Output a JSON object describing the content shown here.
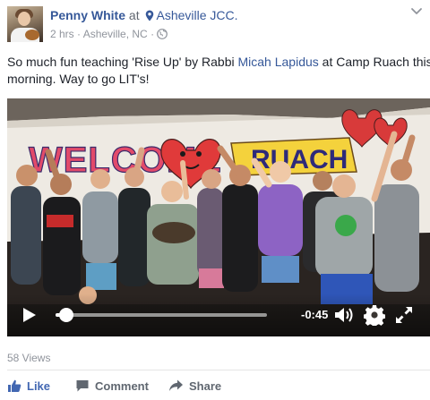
{
  "post": {
    "author": "Penny White",
    "at_text": "at",
    "location": "Asheville JCC.",
    "time": "2 hrs",
    "separator": "·",
    "city": "Asheville, NC",
    "text_before": "So much fun teaching 'Rise Up' by Rabbi ",
    "text_link": "Micah Lapidus",
    "text_after": " at Camp Ruach this",
    "text_line2": "morning. Way to go LIT's!"
  },
  "video": {
    "banner_text": "WELCOME to",
    "sign_text": "RUACH",
    "time_remaining": "-0:45",
    "progress_fraction": 0.05
  },
  "stats": {
    "views": "58 Views"
  },
  "actions": {
    "like": "Like",
    "comment": "Comment",
    "share": "Share"
  },
  "icons": [
    "avatar",
    "location-pin-icon",
    "globe-icon",
    "chevron-down-icon",
    "play-icon",
    "volume-icon",
    "gear-icon",
    "fullscreen-icon",
    "thumbs-up-icon",
    "comment-icon",
    "share-icon"
  ],
  "colors": {
    "link": "#365899",
    "like": "#4267b2",
    "meta": "#90949c",
    "text": "#1d2129"
  }
}
